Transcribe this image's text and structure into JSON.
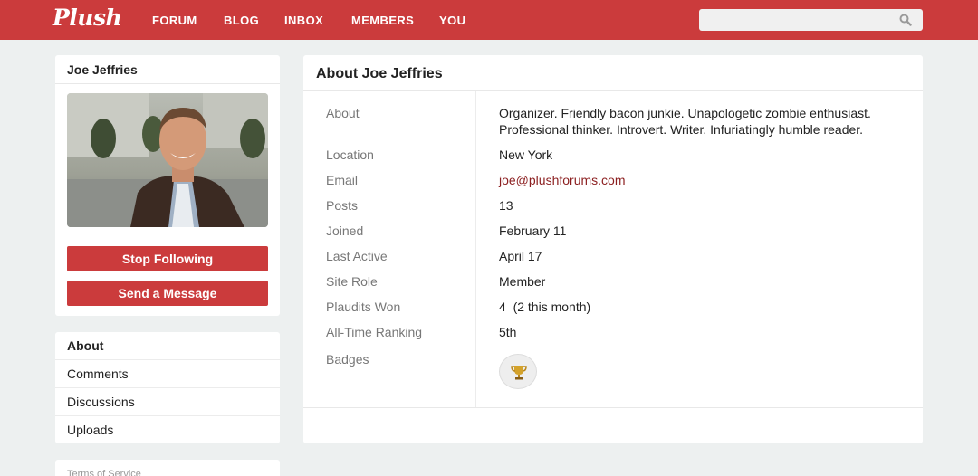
{
  "header": {
    "logo": "Plush",
    "nav": [
      "FORUM",
      "BLOG",
      "INBOX",
      "MEMBERS",
      "YOU"
    ],
    "search": {
      "placeholder": "",
      "value": ""
    },
    "colors": {
      "brand": "#cb3b3c"
    }
  },
  "profile": {
    "name": "Joe Jeffries",
    "follow_button": "Stop Following",
    "message_button": "Send a Message"
  },
  "menu": {
    "items": [
      "About",
      "Comments",
      "Discussions",
      "Uploads"
    ],
    "active": "About"
  },
  "footer": {
    "tos": "Terms of Service"
  },
  "about": {
    "title": "About Joe Jeffries",
    "about_label": "About",
    "about_line1": "Organizer. Friendly bacon junkie. Unapologetic zombie enthusiast.",
    "about_line2": "Professional thinker. Introvert. Writer. Infuriatingly humble reader.",
    "fields": [
      {
        "label": "Location",
        "value": "New York"
      },
      {
        "label": "Email",
        "value": "joe@plushforums.com"
      },
      {
        "label": "Posts",
        "value": "13"
      },
      {
        "label": "Joined",
        "value": "February 11"
      },
      {
        "label": "Last Active",
        "value": "April 17"
      },
      {
        "label": "Site Role",
        "value": "Member"
      },
      {
        "label": "Plaudits Won",
        "value": "4  (2 this month)"
      },
      {
        "label": "All-Time Ranking",
        "value": "5th"
      }
    ],
    "badges_label": "Badges",
    "badges": [
      "trophy-icon"
    ]
  }
}
